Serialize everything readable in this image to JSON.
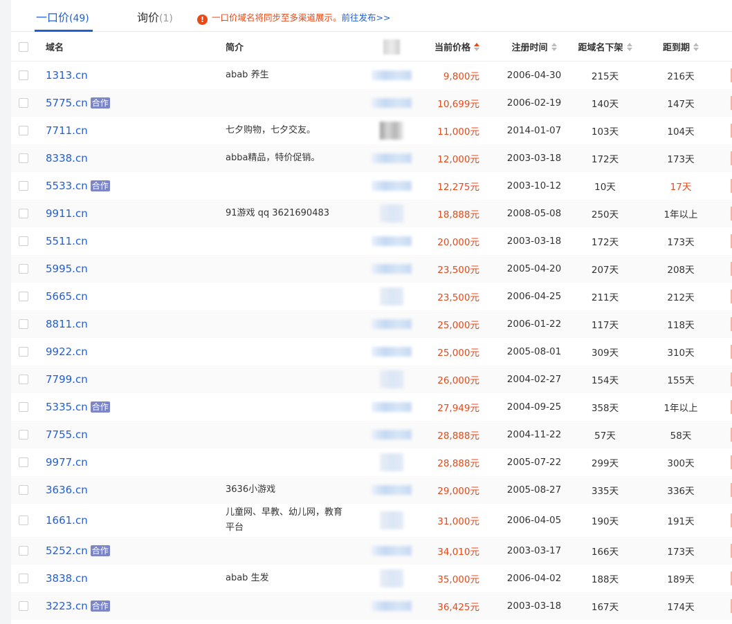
{
  "tabs": [
    {
      "label": "一口价",
      "count": "(49)"
    },
    {
      "label": "询价",
      "count": "(1)"
    }
  ],
  "notice": {
    "icon": "!",
    "text": "一口价域名将同步至多渠道展示。",
    "link": "前往发布>>"
  },
  "columns": {
    "domain": "域名",
    "desc": "简介",
    "price": "当前价格",
    "regdate": "注册时间",
    "offshelf": "距域名下架",
    "expiry": "距到期"
  },
  "rows": [
    {
      "domain": "1313.cn",
      "badge": "",
      "desc": "abab 养生",
      "price": "9,800元",
      "regdate": "2006-04-30",
      "offshelf": "215天",
      "expiry": "216天"
    },
    {
      "domain": "5775.cn",
      "badge": "合作",
      "desc": "",
      "price": "10,699元",
      "regdate": "2006-02-19",
      "offshelf": "140天",
      "expiry": "147天"
    },
    {
      "domain": "7711.cn",
      "badge": "",
      "desc": "七夕购物，七夕交友。",
      "price": "11,000元",
      "regdate": "2014-01-07",
      "offshelf": "103天",
      "expiry": "104天"
    },
    {
      "domain": "8338.cn",
      "badge": "",
      "desc": "abba精品，特价促销。",
      "price": "12,000元",
      "regdate": "2003-03-18",
      "offshelf": "172天",
      "expiry": "173天"
    },
    {
      "domain": "5533.cn",
      "badge": "合作",
      "desc": "",
      "price": "12,275元",
      "regdate": "2003-10-12",
      "offshelf": "10天",
      "expiry": "17天"
    },
    {
      "domain": "9911.cn",
      "badge": "",
      "desc": "91游戏 qq 3621690483",
      "price": "18,888元",
      "regdate": "2008-05-08",
      "offshelf": "250天",
      "expiry": "1年以上"
    },
    {
      "domain": "5511.cn",
      "badge": "",
      "desc": "",
      "price": "20,000元",
      "regdate": "2003-03-18",
      "offshelf": "172天",
      "expiry": "173天"
    },
    {
      "domain": "5995.cn",
      "badge": "",
      "desc": "",
      "price": "23,500元",
      "regdate": "2005-04-20",
      "offshelf": "207天",
      "expiry": "208天"
    },
    {
      "domain": "5665.cn",
      "badge": "",
      "desc": "",
      "price": "23,500元",
      "regdate": "2006-04-25",
      "offshelf": "211天",
      "expiry": "212天"
    },
    {
      "domain": "8811.cn",
      "badge": "",
      "desc": "",
      "price": "25,000元",
      "regdate": "2006-01-22",
      "offshelf": "117天",
      "expiry": "118天"
    },
    {
      "domain": "9922.cn",
      "badge": "",
      "desc": "",
      "price": "25,000元",
      "regdate": "2005-08-01",
      "offshelf": "309天",
      "expiry": "310天"
    },
    {
      "domain": "7799.cn",
      "badge": "",
      "desc": "",
      "price": "26,000元",
      "regdate": "2004-02-27",
      "offshelf": "154天",
      "expiry": "155天"
    },
    {
      "domain": "5335.cn",
      "badge": "合作",
      "desc": "",
      "price": "27,949元",
      "regdate": "2004-09-25",
      "offshelf": "358天",
      "expiry": "1年以上"
    },
    {
      "domain": "7755.cn",
      "badge": "",
      "desc": "",
      "price": "28,888元",
      "regdate": "2004-11-22",
      "offshelf": "57天",
      "expiry": "58天"
    },
    {
      "domain": "9977.cn",
      "badge": "",
      "desc": "",
      "price": "28,888元",
      "regdate": "2005-07-22",
      "offshelf": "299天",
      "expiry": "300天"
    },
    {
      "domain": "3636.cn",
      "badge": "",
      "desc": "3636小游戏",
      "price": "29,000元",
      "regdate": "2005-08-27",
      "offshelf": "335天",
      "expiry": "336天"
    },
    {
      "domain": "1661.cn",
      "badge": "",
      "desc": "儿童网、早教、幼儿网，教育平台",
      "price": "31,000元",
      "regdate": "2006-04-05",
      "offshelf": "190天",
      "expiry": "191天"
    },
    {
      "domain": "5252.cn",
      "badge": "合作",
      "desc": "",
      "price": "34,010元",
      "regdate": "2003-03-17",
      "offshelf": "166天",
      "expiry": "173天"
    },
    {
      "domain": "3838.cn",
      "badge": "",
      "desc": "abab 生发",
      "price": "35,000元",
      "regdate": "2006-04-02",
      "offshelf": "188天",
      "expiry": "189天"
    },
    {
      "domain": "3223.cn",
      "badge": "合作",
      "desc": "",
      "price": "36,425元",
      "regdate": "2003-03-18",
      "offshelf": "167天",
      "expiry": "174天"
    }
  ],
  "colors": {
    "accent": "#1e5fd8",
    "price": "#e94817",
    "badge": "#7b86c9"
  }
}
